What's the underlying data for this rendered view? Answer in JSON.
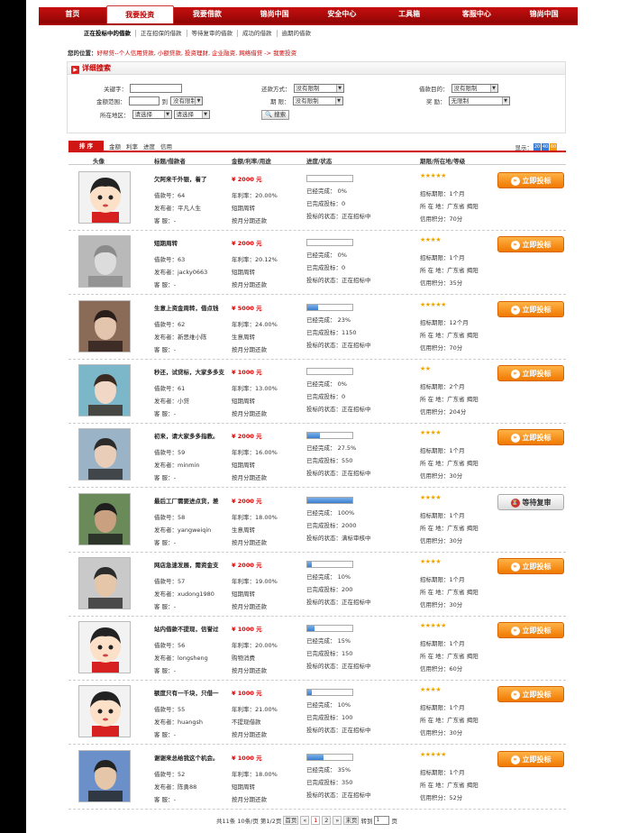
{
  "nav": {
    "items": [
      "首页",
      "我要投资",
      "我要借款",
      "锦尚中国",
      "安全中心",
      "工具箱",
      "客服中心",
      "锦尚中国"
    ],
    "active": 1
  },
  "subnav": {
    "items": [
      "正在投标中的借款",
      "正在招保的借款",
      "等待复审的借款",
      "成功的借款",
      "逾期的借款"
    ],
    "active": 0
  },
  "location": {
    "label": "您的位置：",
    "path": "好帮贷--个人信用贷款, 小额贷款, 投资理财, 企业融资, 网络借贷 -> 我要投资"
  },
  "search": {
    "title": "详细搜索",
    "keyword_label": "关键字：",
    "amount_label": "金额范围：",
    "amount_to": "到",
    "amount_select": "没有限制",
    "region_label": "所在地区：",
    "region_select1": "请选择",
    "region_select2": "请选择",
    "repay_label": "还款方式：",
    "repay_select": "没有限制",
    "period_label": "期    限：",
    "period_select": "没有限制",
    "purpose_label": "借款目的：",
    "purpose_select": "没有限制",
    "reward_label": "奖    励：",
    "reward_select": "无限制",
    "button": "搜索"
  },
  "sort": {
    "title": "排 序",
    "options": [
      "金额",
      "利率",
      "进度",
      "信用"
    ],
    "display_label": "显示：",
    "page_sizes": [
      "20",
      "40",
      "60"
    ]
  },
  "table_headers": [
    "头像",
    "标题/借款者",
    "金额/利率/用途",
    "进度/状态",
    "期限/所在地/等级"
  ],
  "rows": [
    {
      "title": "欠阿来千外银，着了",
      "no": "借款号：64",
      "borrower": "发布者：平凡人生",
      "service": "客    服：-",
      "amount": "¥ 2000 元",
      "rate": "年利率：20.00%",
      "use": "短期周转",
      "repay": "按月分期还款",
      "done": "已经完成：  0%",
      "done_pct": 0,
      "bids": "已完成投标：0",
      "status": "投标的状态：正在招标中",
      "stars": 5,
      "period": "招标期限：1个月",
      "place": "所 在 地：广东省  揭阳",
      "credit": "信用积分：70分",
      "action": "立即投标",
      "wait": false,
      "avatar": "cartoon"
    },
    {
      "title": "短期周转",
      "no": "借款号：63",
      "borrower": "发布者：jacky0663",
      "service": "客    服：-",
      "amount": "¥ 2000 元",
      "rate": "年利率：20.12%",
      "use": "短期周转",
      "repay": "按月分期还款",
      "done": "已经完成：  0%",
      "done_pct": 0,
      "bids": "已完成投标：0",
      "status": "投标的状态：正在招标中",
      "stars": 4,
      "period": "招标期限：1个月",
      "place": "所 在 地：广东省  揭阳",
      "credit": "信用积分：35分",
      "action": "立即投标",
      "wait": false,
      "avatar": "photo-gray"
    },
    {
      "title": "生意上资金周转，借点钱",
      "no": "借款号：62",
      "borrower": "发布者：新思维小陈",
      "service": "客    服：-",
      "amount": "¥ 5000 元",
      "rate": "年利率：24.00%",
      "use": "生意周转",
      "repay": "按月分期还款",
      "done": "已经完成：  23%",
      "done_pct": 23,
      "bids": "已完成投标：1150",
      "status": "投标的状态：正在招标中",
      "stars": 5,
      "period": "招标期限：12个月",
      "place": "所 在 地：广东省  揭阳",
      "credit": "信用积分：70分",
      "action": "立即投标",
      "wait": false,
      "avatar": "photo-man"
    },
    {
      "title": "秒还，试贷标，大家多多支",
      "no": "借款号：61",
      "borrower": "发布者：小贷",
      "service": "客    服：-",
      "amount": "¥ 1000 元",
      "rate": "年利率：13.00%",
      "use": "短期周转",
      "repay": "按月分期还款",
      "done": "已经完成：  0%",
      "done_pct": 0,
      "bids": "已完成投标：0",
      "status": "投标的状态：正在招标中",
      "stars": 2,
      "period": "招标期限：2个月",
      "place": "所 在 地：广东省  揭阳",
      "credit": "信用积分：204分",
      "action": "立即投标",
      "wait": false,
      "avatar": "photo-woman"
    },
    {
      "title": "初来，请大家多多指教。",
      "no": "借款号：59",
      "borrower": "发布者：minmin",
      "service": "客    服：-",
      "amount": "¥ 2000 元",
      "rate": "年利率：16.00%",
      "use": "短期周转",
      "repay": "按月分期还款",
      "done": "已经完成：  27.5%",
      "done_pct": 27.5,
      "bids": "已完成投标：550",
      "status": "投标的状态：正在招标中",
      "stars": 4,
      "period": "招标期限：1个月",
      "place": "所 在 地：广东省  揭阳",
      "credit": "信用积分：30分",
      "action": "立即投标",
      "wait": false,
      "avatar": "photo-man2"
    },
    {
      "title": "最后工厂需要进点货，差",
      "no": "借款号：58",
      "borrower": "发布者：yangweiqin",
      "service": "客    服：-",
      "amount": "¥ 2000 元",
      "rate": "年利率：18.00%",
      "use": "生意周转",
      "repay": "按月分期还款",
      "done": "已经完成：  100%",
      "done_pct": 100,
      "bids": "已完成投标：2000",
      "status": "投标的状态：满标审核中",
      "stars": 4,
      "period": "招标期限：1个月",
      "place": "所 在 地：广东省  揭阳",
      "credit": "信用积分：30分",
      "action": "等待复审",
      "wait": true,
      "avatar": "photo-man3"
    },
    {
      "title": "网店急速发展，需资金支",
      "no": "借款号：57",
      "borrower": "发布者：xudong1980",
      "service": "客    服：-",
      "amount": "¥ 2000 元",
      "rate": "年利率：19.00%",
      "use": "短期周转",
      "repay": "按月分期还款",
      "done": "已经完成：  10%",
      "done_pct": 10,
      "bids": "已完成投标：200",
      "status": "投标的状态：正在招标中",
      "stars": 4,
      "period": "招标期限：1个月",
      "place": "所 在 地：广东省  揭阳",
      "credit": "信用积分：30分",
      "action": "立即投标",
      "wait": false,
      "avatar": "photo-man4"
    },
    {
      "title": "站内借款不提现，信誉过",
      "no": "借款号：56",
      "borrower": "发布者：longsheng",
      "service": "客    服：-",
      "amount": "¥ 1000 元",
      "rate": "年利率：20.00%",
      "use": "购物消费",
      "repay": "按月分期还款",
      "done": "已经完成：  15%",
      "done_pct": 15,
      "bids": "已完成投标：150",
      "status": "投标的状态：正在招标中",
      "stars": 5,
      "period": "招标期限：1个月",
      "place": "所 在 地：广东省  揭阳",
      "credit": "信用积分：60分",
      "action": "立即投标",
      "wait": false,
      "avatar": "cartoon"
    },
    {
      "title": "额度只有一千块，只借一",
      "no": "借款号：55",
      "borrower": "发布者：huangsh",
      "service": "客    服：-",
      "amount": "¥ 1000 元",
      "rate": "年利率：21.00%",
      "use": "不提现借款",
      "repay": "按月分期还款",
      "done": "已经完成：  10%",
      "done_pct": 10,
      "bids": "已完成投标：100",
      "status": "投标的状态：正在招标中",
      "stars": 4,
      "period": "招标期限：1个月",
      "place": "所 在 地：广东省  揭阳",
      "credit": "信用积分：30分",
      "action": "立即投标",
      "wait": false,
      "avatar": "cartoon"
    },
    {
      "title": "谢谢来总给我这个机会。",
      "no": "借款号：52",
      "borrower": "发布者：陈勇88",
      "service": "客    服：-",
      "amount": "¥ 1000 元",
      "rate": "年利率：18.00%",
      "use": "短期周转",
      "repay": "按月分期还款",
      "done": "已经完成：  35%",
      "done_pct": 35,
      "bids": "已完成投标：350",
      "status": "投标的状态：正在招标中",
      "stars": 5,
      "period": "招标期限：1个月",
      "place": "所 在 地：广东省  揭阳",
      "credit": "信用积分：52分",
      "action": "立即投标",
      "wait": false,
      "avatar": "photo-man5"
    }
  ],
  "pager": {
    "total": "共11条",
    "per_page": "10条/页",
    "page_of": "第1/2页",
    "first": "首页",
    "prev": "«",
    "p1": "1",
    "p2": "2",
    "next": "»",
    "last": "末页",
    "goto_label": "转到",
    "goto_value": "1",
    "goto_unit": "页"
  },
  "colors": {
    "brand_red": "#c70f0f",
    "bid_orange": "#f07800",
    "progress_blue": "#3b7ed0"
  }
}
